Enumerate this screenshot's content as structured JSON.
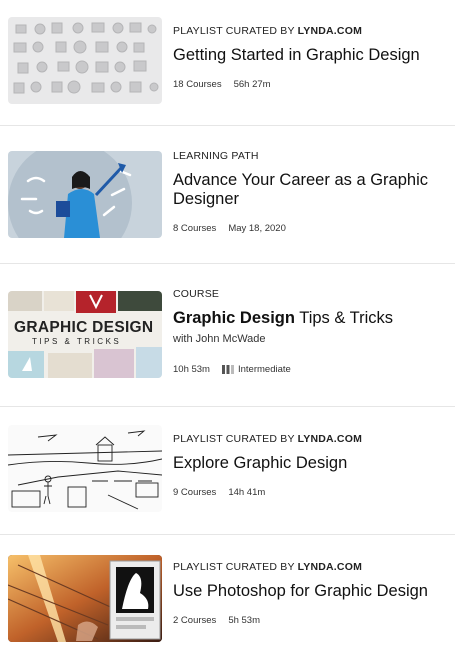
{
  "items": [
    {
      "eyebrow_prefix": "PLAYLIST CURATED BY ",
      "eyebrow_brand": "LYNDA.COM",
      "title": "Getting Started in Graphic Design",
      "stat1": "18 Courses",
      "stat2": "56h 27m"
    },
    {
      "eyebrow_prefix": "LEARNING PATH",
      "title": "Advance Your Career as a Graphic Designer",
      "stat1": "8 Courses",
      "stat2": "May 18, 2020"
    },
    {
      "eyebrow_prefix": "COURSE",
      "title_bold": "Graphic Design",
      "title_rest": " Tips & Tricks",
      "author": "with John McWade",
      "stat1": "10h 53m",
      "stat2": "Intermediate",
      "thumb_text": "GRAPHIC DESIGN",
      "thumb_subtext": "TIPS & TRICKS"
    },
    {
      "eyebrow_prefix": "PLAYLIST CURATED BY ",
      "eyebrow_brand": "LYNDA.COM",
      "title": "Explore Graphic Design",
      "stat1": "9 Courses",
      "stat2": "14h 41m"
    },
    {
      "eyebrow_prefix": "PLAYLIST CURATED BY ",
      "eyebrow_brand": "LYNDA.COM",
      "title": "Use Photoshop for Graphic Design",
      "stat1": "2 Courses",
      "stat2": "5h 53m"
    }
  ]
}
